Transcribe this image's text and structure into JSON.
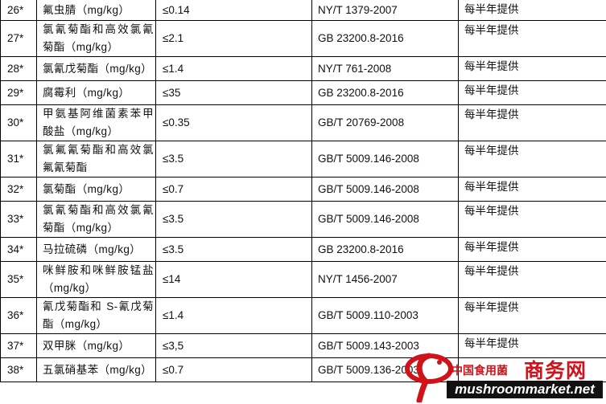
{
  "rows": [
    {
      "no": "26*",
      "item": "氟虫腈（mg/kg）",
      "limit": "≤0.14",
      "method": "NY/T 1379-2007",
      "frequency": "每半年提供"
    },
    {
      "no": "27*",
      "item": "氯氰菊酯和高效氯氰菊酯（mg/kg）",
      "limit": "≤2.1",
      "method": "GB 23200.8-2016",
      "frequency": "每半年提供"
    },
    {
      "no": "28*",
      "item": "氯氰戊菊酯（mg/kg）",
      "limit": "≤1.4",
      "method": "NY/T 761-2008",
      "frequency": "每半年提供"
    },
    {
      "no": "29*",
      "item": "腐霉利（mg/kg）",
      "limit": "≤35",
      "method": "GB 23200.8-2016",
      "frequency": "每半年提供"
    },
    {
      "no": "30*",
      "item": "甲氨基阿维菌素苯甲酸盐（mg/kg）",
      "limit": "≤0.35",
      "method": "GB/T 20769-2008",
      "frequency": "每半年提供"
    },
    {
      "no": "31*",
      "item": "氯氟氰菊酯和高效氯氟氰菊酯",
      "limit": "≤3.5",
      "method": "GB/T 5009.146-2008",
      "frequency": "每半年提供"
    },
    {
      "no": "32*",
      "item": "氯菊酯（mg/kg）",
      "limit": "≤0.7",
      "method": "GB/T 5009.146-2008",
      "frequency": "每半年提供"
    },
    {
      "no": "33*",
      "item": "氯氰菊酯和高效氯氰菊酯（mg/kg）",
      "limit": "≤3.5",
      "method": "GB/T 5009.146-2008",
      "frequency": "每半年提供"
    },
    {
      "no": "34*",
      "item": "马拉硫磷（mg/kg）",
      "limit": "≤3.5",
      "method": "GB 23200.8-2016",
      "frequency": "每半年提供"
    },
    {
      "no": "35*",
      "item": "咪鲜胺和咪鲜胺锰盐（mg/kg）",
      "limit": "≤14",
      "method": "NY/T 1456-2007",
      "frequency": "每半年提供"
    },
    {
      "no": "36*",
      "item": "氰戊菊酯和 S-氰戊菊酯（mg/kg）",
      "limit": "≤1.4",
      "method": "GB/T 5009.110-2003",
      "frequency": "每半年提供"
    },
    {
      "no": "37*",
      "item": "双甲脒（mg/kg）",
      "limit": "≤3,5",
      "method": "GB/T 5009.143-2003",
      "frequency": "每半年提供"
    },
    {
      "no": "38*",
      "item": "五氯硝基苯（mg/kg）",
      "limit": "≤0.7",
      "method": "GB/T 5009.136-2003",
      "frequency": ""
    }
  ],
  "watermark": {
    "cn_small": "中国食用菌",
    "cn_big": "商务网",
    "url": "mushroommarket.net"
  },
  "colors": {
    "watermark_red": "#d0121b",
    "watermark_url_bg": "#111111"
  }
}
